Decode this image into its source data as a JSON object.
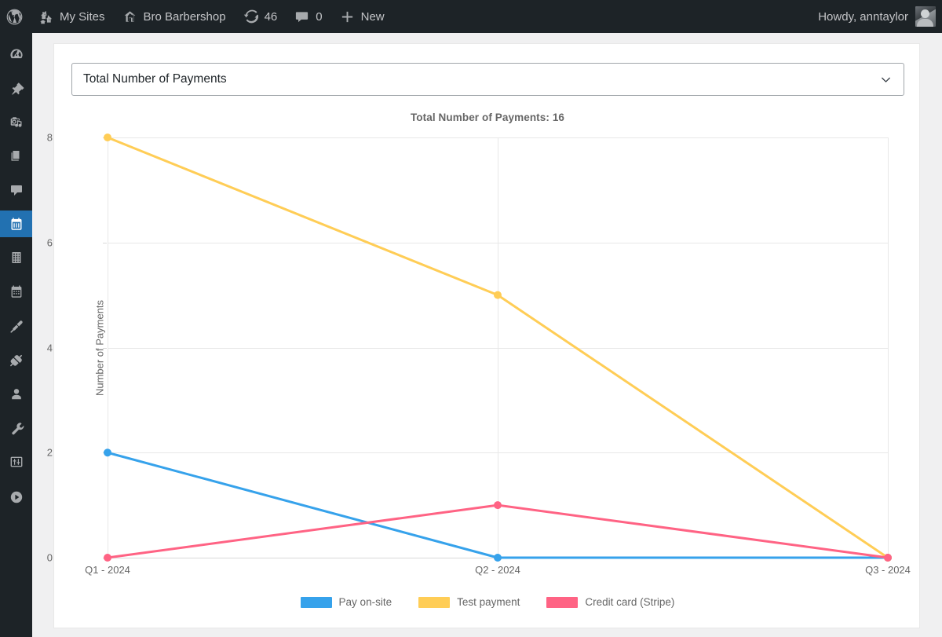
{
  "adminbar": {
    "logo_icon": "wordpress-logo-icon",
    "items": [
      {
        "icon": "my-sites-icon",
        "label": "My Sites"
      },
      {
        "icon": "site-home-icon",
        "label": "Bro Barbershop"
      },
      {
        "icon": "updates-icon",
        "label": "46"
      },
      {
        "icon": "comments-icon",
        "label": "0"
      },
      {
        "icon": "plus-icon",
        "label": "New"
      }
    ],
    "howdy": "Howdy, anntaylor",
    "avatar_icon": "user-avatar"
  },
  "adminmenu": {
    "items": [
      {
        "name": "dashboard",
        "icon": "dashboard-gauge-icon",
        "current": false
      },
      {
        "name": "posts",
        "icon": "pin-icon",
        "current": false
      },
      {
        "name": "media",
        "icon": "media-camera-music-icon",
        "current": false
      },
      {
        "name": "pages",
        "icon": "pages-icon",
        "current": false
      },
      {
        "name": "comments",
        "icon": "comment-bubble-icon",
        "current": false
      },
      {
        "name": "bookings",
        "icon": "calendar-icon",
        "current": true
      },
      {
        "name": "buildings",
        "icon": "building-grid-icon",
        "current": false
      },
      {
        "name": "events",
        "icon": "calendar-alt-icon",
        "current": false
      },
      {
        "name": "appearance",
        "icon": "paint-brush-icon",
        "current": false
      },
      {
        "name": "plugins",
        "icon": "plug-icon",
        "current": false
      },
      {
        "name": "users",
        "icon": "user-icon",
        "current": false
      },
      {
        "name": "tools",
        "icon": "wrench-icon",
        "current": false
      },
      {
        "name": "settings",
        "icon": "sliders-icon",
        "current": false
      },
      {
        "name": "collapse",
        "icon": "play-circle-icon",
        "current": false
      }
    ]
  },
  "metric_select": {
    "value": "Total Number of Payments",
    "chevron_icon": "chevron-down-icon",
    "options": [
      "Total Number of Payments"
    ]
  },
  "chart_data": {
    "type": "line",
    "title": "Total Number of Payments: 16",
    "xlabel": "",
    "ylabel": "Number of Payments",
    "categories": [
      "Q1 - 2024",
      "Q2 - 2024",
      "Q3 - 2024"
    ],
    "ylim": [
      0,
      8
    ],
    "yticks": [
      0,
      2,
      4,
      6,
      8
    ],
    "grid": true,
    "legend_position": "bottom",
    "series": [
      {
        "name": "Pay on-site",
        "color": "#36A2EB",
        "values": [
          2,
          0,
          0
        ]
      },
      {
        "name": "Test payment",
        "color": "#FFCD56",
        "values": [
          8,
          5,
          0
        ]
      },
      {
        "name": "Credit card (Stripe)",
        "color": "#FF6384",
        "values": [
          0,
          1,
          0
        ]
      }
    ]
  },
  "colors": {
    "admin_dark": "#1d2327",
    "admin_accent": "#2271b1",
    "page_bg": "#f0f0f1",
    "card_bg": "#ffffff",
    "axis_text": "#666666"
  }
}
